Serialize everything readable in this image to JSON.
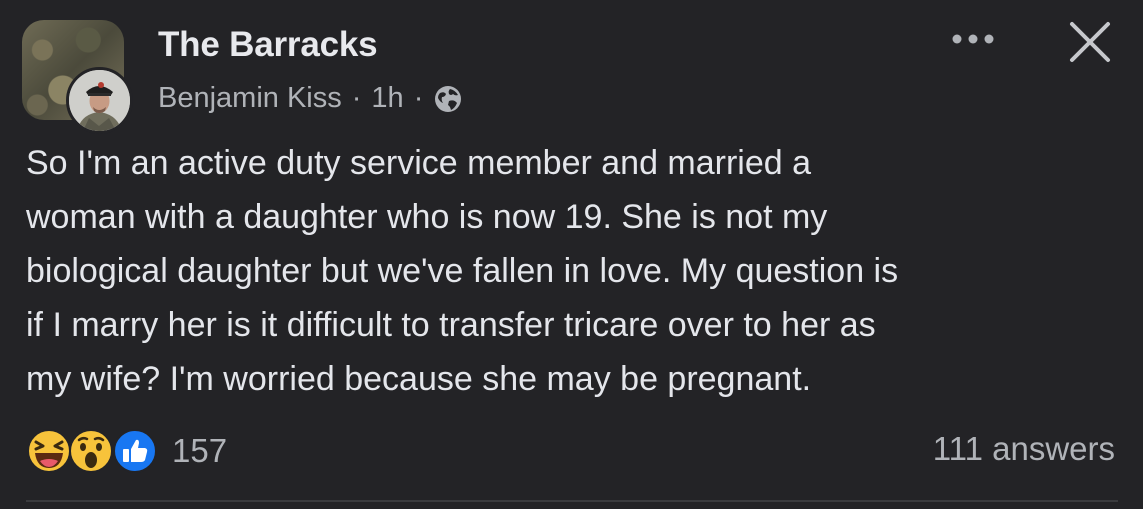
{
  "post": {
    "group_name": "The Barracks",
    "author": "Benjamin Kiss",
    "separator": "·",
    "time": "1h",
    "visibility_icon": "globe-icon",
    "text": "So I'm an active duty service member and married a\nwoman with a daughter who is now 19. She is not my\nbiological daughter but we've fallen in love. My question is\nif I marry her is it difficult to transfer tricare over to her as\nmy wife? I'm worried because she may be pregnant."
  },
  "header_actions": {
    "more_icon": "more-options-icon",
    "close_icon": "close-icon"
  },
  "footer": {
    "reaction_icons": [
      "haha-reaction-icon",
      "wow-reaction-icon",
      "like-reaction-icon"
    ],
    "reaction_count": "157",
    "answers": "111 answers"
  },
  "colors": {
    "background": "#232326",
    "text_primary": "#e4e6eb",
    "text_secondary": "#b0b3b8",
    "like_blue": "#1877f2",
    "emoji_yellow": "#f7c33b"
  }
}
